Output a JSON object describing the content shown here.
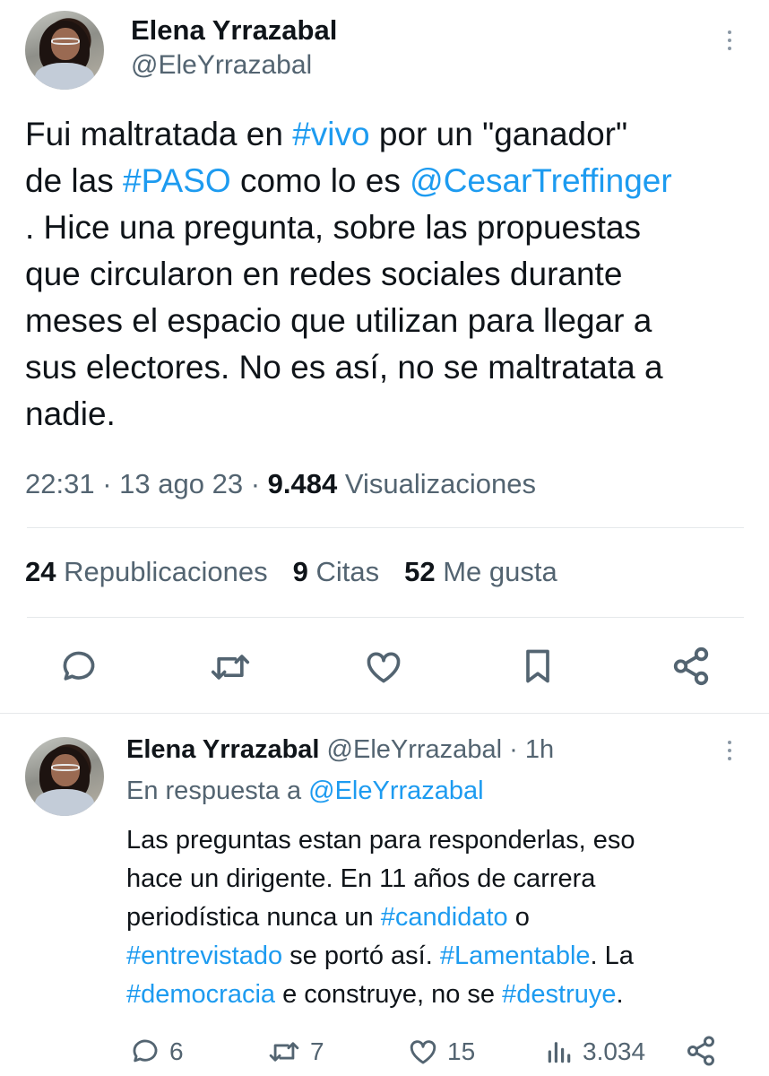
{
  "tweet": {
    "author": {
      "name": "Elena Yrrazabal",
      "handle": "@EleYrrazabal"
    },
    "text": {
      "line1_pre": "Fui maltratada en ",
      "line1_tag": "#vivo",
      "line1_post": " por un \"ganador\"",
      "line2_pre": "de las ",
      "line2_tag": "#PASO",
      "line2_mid": " como lo es ",
      "line2_mention": "@CesarTreffinger",
      "line3": ". Hice una pregunta, sobre las propuestas",
      "line4": "que circularon en redes sociales durante",
      "line5": "meses el espacio que utilizan para llegar a",
      "line6": "sus electores. No es así, no se maltratata a",
      "line7": "nadie."
    },
    "meta": {
      "time": "22:31",
      "date": "13 ago 23",
      "views_count": "9.484",
      "views_label": "Visualizaciones",
      "sep": "·"
    },
    "stats": {
      "reposts_count": "24",
      "reposts_label": "Republicaciones",
      "quotes_count": "9",
      "quotes_label": "Citas",
      "likes_count": "52",
      "likes_label": "Me gusta"
    },
    "actions": [
      "reply-icon",
      "repost-icon",
      "like-icon",
      "bookmark-icon",
      "share-icon"
    ]
  },
  "reply": {
    "author": {
      "name": "Elena Yrrazabal",
      "handle": "@EleYrrazabal",
      "sep": "·",
      "time": "1h"
    },
    "in_reply_to_label": "En respuesta a ",
    "in_reply_to_handle": "@EleYrrazabal",
    "text": {
      "line1": "Las preguntas estan para responderlas, eso",
      "line2": "hace un dirigente. En 11 años de carrera",
      "line3_pre": "periodística nunca un ",
      "line3_tag": "#candidato",
      "line3_post": " o",
      "line4_tag1": "#entrevistado",
      "line4_mid": " se portó así. ",
      "line4_tag2": "#Lamentable",
      "line4_post": ". La",
      "line5_tag1": "#democracia",
      "line5_mid": " e construye, no se ",
      "line5_tag2": "#destruye",
      "line5_post": "."
    },
    "actions": {
      "replies": "6",
      "reposts": "7",
      "likes": "15",
      "views": "3.034"
    }
  },
  "colors": {
    "link": "#1d9bf0",
    "text": "#0f1419",
    "muted": "#536471"
  }
}
